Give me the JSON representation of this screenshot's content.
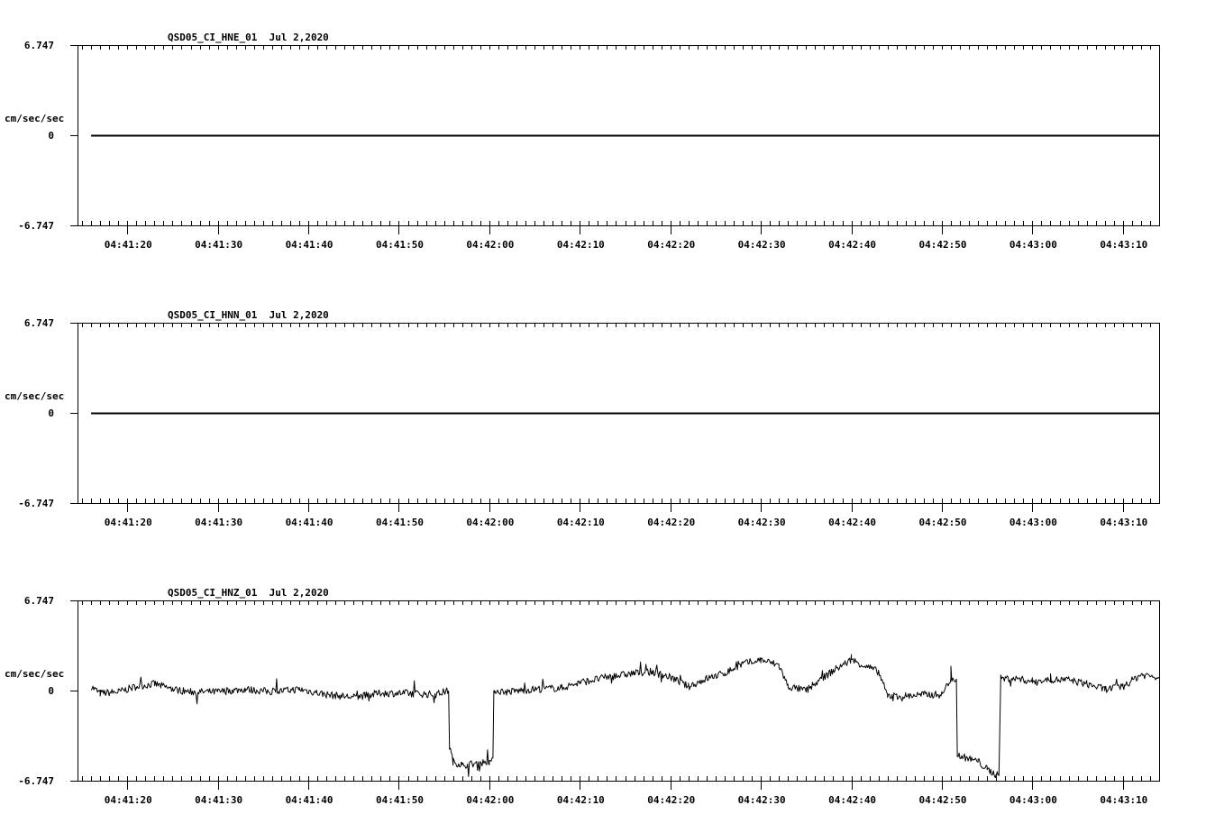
{
  "chart_data": [
    {
      "type": "line",
      "title": "QSD05_CI_HNE_01  Jul 2,2020",
      "ylabel": "cm/sec/sec",
      "ylim": [
        -6.747,
        6.747
      ],
      "ytick_labels": [
        "6.747",
        "0",
        "-6.747"
      ],
      "xtick_labels": [
        "04:41:20",
        "04:41:30",
        "04:41:40",
        "04:41:50",
        "04:42:00",
        "04:42:10",
        "04:42:20",
        "04:42:30",
        "04:42:40",
        "04:42:50",
        "04:43:00",
        "04:43:10"
      ],
      "x_start": "04:41:14.5",
      "x_end": "04:43:14.0",
      "series": [
        {
          "x": [
            "04:41:16",
            "04:43:14"
          ],
          "values": [
            0,
            0
          ]
        }
      ]
    },
    {
      "type": "line",
      "title": "QSD05_CI_HNN_01  Jul 2,2020",
      "ylabel": "cm/sec/sec",
      "ylim": [
        -6.747,
        6.747
      ],
      "ytick_labels": [
        "6.747",
        "0",
        "-6.747"
      ],
      "xtick_labels": [
        "04:41:20",
        "04:41:30",
        "04:41:40",
        "04:41:50",
        "04:42:00",
        "04:42:10",
        "04:42:20",
        "04:42:30",
        "04:42:40",
        "04:42:50",
        "04:43:00",
        "04:43:10"
      ],
      "x_start": "04:41:14.5",
      "x_end": "04:43:14.0",
      "series": [
        {
          "x": [
            "04:41:16",
            "04:43:14"
          ],
          "values": [
            0,
            0
          ]
        }
      ]
    },
    {
      "type": "line",
      "title": "QSD05_CI_HNZ_01  Jul 2,2020",
      "ylabel": "cm/sec/sec",
      "ylim": [
        -6.747,
        6.747
      ],
      "ytick_labels": [
        "6.747",
        "0",
        "-6.747"
      ],
      "xtick_labels": [
        "04:41:20",
        "04:41:30",
        "04:41:40",
        "04:41:50",
        "04:42:00",
        "04:42:10",
        "04:42:20",
        "04:42:30",
        "04:42:40",
        "04:42:50",
        "04:43:00",
        "04:43:10"
      ],
      "x_start": "04:41:14.5",
      "x_end": "04:43:14.0",
      "series": [
        {
          "x": [
            "04:41:16",
            "04:41:17",
            "04:41:19",
            "04:41:21",
            "04:41:23",
            "04:41:25",
            "04:41:27",
            "04:41:30",
            "04:41:33",
            "04:41:36",
            "04:41:39",
            "04:41:42",
            "04:41:45",
            "04:41:48",
            "04:41:51",
            "04:41:54",
            "04:41:55.5",
            "04:41:55.6",
            "04:41:56",
            "04:41:57",
            "04:41:59",
            "04:42:00",
            "04:42:00.4",
            "04:42:00.5",
            "04:42:02",
            "04:42:05",
            "04:42:08",
            "04:42:10",
            "04:42:13",
            "04:42:16",
            "04:42:18",
            "04:42:20",
            "04:42:22",
            "04:42:24",
            "04:42:26",
            "04:42:28",
            "04:42:30",
            "04:42:32",
            "04:42:33",
            "04:42:35",
            "04:42:37",
            "04:42:38",
            "04:42:40",
            "04:42:42",
            "04:42:43",
            "04:42:44",
            "04:42:46",
            "04:42:48",
            "04:42:50",
            "04:42:51",
            "04:42:51.6",
            "04:42:51.7",
            "04:42:52",
            "04:42:53",
            "04:42:54",
            "04:42:55",
            "04:42:56",
            "04:42:56.3",
            "04:42:56.5",
            "04:42:58",
            "04:43:00",
            "04:43:02",
            "04:43:04",
            "04:43:06",
            "04:43:08",
            "04:43:10",
            "04:43:12",
            "04:43:14"
          ],
          "values": [
            0.3,
            -0.2,
            -0.1,
            0.3,
            0.5,
            0.1,
            -0.1,
            -0.1,
            0.1,
            -0.1,
            0.1,
            -0.3,
            -0.5,
            -0.2,
            -0.2,
            -0.3,
            0.0,
            -4.2,
            -5.3,
            -5.6,
            -5.4,
            -5.3,
            -5.3,
            0.0,
            -0.1,
            0.1,
            0.2,
            0.6,
            1.0,
            1.3,
            1.4,
            1.0,
            0.3,
            0.9,
            1.3,
            2.0,
            2.3,
            1.9,
            0.3,
            0.0,
            1.0,
            1.5,
            2.3,
            1.7,
            1.4,
            -0.4,
            -0.4,
            -0.3,
            -0.3,
            0.9,
            0.9,
            -4.8,
            -4.9,
            -5.1,
            -5.3,
            -5.9,
            -6.3,
            -6.1,
            0.9,
            0.9,
            0.7,
            0.8,
            0.8,
            0.5,
            0.1,
            0.3,
            1.2,
            1.0
          ]
        }
      ]
    }
  ]
}
